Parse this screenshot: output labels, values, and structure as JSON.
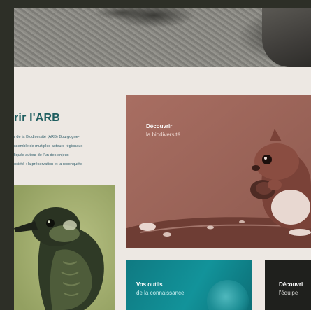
{
  "intro": {
    "title": "rir l'ARB",
    "body_lines": [
      "r de la Biodiversité (ARB) Bourgogne-",
      "ssemble de multiples acteurs régionaux",
      "liqués autour de l'un des enjeux",
      "ociété : la préservation et la reconquête"
    ]
  },
  "cards": {
    "biodiversity": {
      "kicker": "Découvrir",
      "sub": "la biodiversité"
    },
    "tools": {
      "kicker": "Vos outils",
      "sub": "de la connaissance"
    },
    "team": {
      "kicker": "Découvri",
      "sub": "l'équipe"
    }
  },
  "colors": {
    "frame": "#2d2f27",
    "page_bg": "#ede8e3",
    "title": "#1f5e60",
    "squirrel_card": "#9f6559",
    "teal_card": "#12939a",
    "green_card": "#a7b276",
    "dark_card": "#1f201d"
  },
  "images": {
    "top": "rocky-ground-photo",
    "bird": "kingfisher-photo",
    "squirrel": "squirrel-photo",
    "tools": "animal-photo",
    "team": "team-photo"
  }
}
